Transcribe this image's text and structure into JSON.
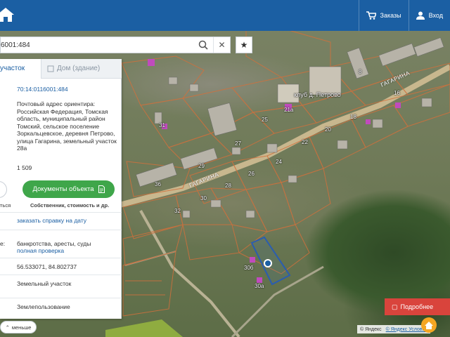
{
  "topbar": {
    "orders_label": "Заказы",
    "login_label": "Вход"
  },
  "search": {
    "value": "6001:484"
  },
  "panel": {
    "tabs": [
      {
        "label": "участок"
      },
      {
        "label": "Дом (здание)"
      }
    ],
    "cadastral_number": "70:14:0116001:484",
    "address": "Почтовый адрес ориентира: Российская Федерация, Томская область, муниципальный район Томский, сельское поселение Зоркальцевское, деревня Петрово, улица Гагарина, земельный участок 28а",
    "area": "1 509",
    "docs_button": "Документы объекта",
    "small_left": "ться",
    "small_right": "Собственник, стоимость и др.",
    "reference_link": "заказать справку на дату",
    "checks_label": "е:",
    "checks_text": "банкротства, аресты, суды",
    "full_check_link": "полная проверка",
    "coords": "56.533071, 84.802737",
    "parcel_type": "Земельный участок",
    "usage": "Землепользование",
    "less_button": "меньше"
  },
  "map": {
    "street_1": "ГАГАРИНА",
    "street_2": "ГАГАРИНА",
    "club_label": "клуб д. Петрово",
    "attribution_1": "© Яндекс",
    "attribution_2": "© Яндекс Условия",
    "badge_label": "Подробнее",
    "labels": [
      "21а",
      "25",
      "18",
      "20",
      "22",
      "27",
      "24",
      "26",
      "28",
      "29",
      "31",
      "30",
      "30б",
      "30а",
      "32",
      "36",
      "8",
      "16"
    ]
  },
  "colors": {
    "header": "#1b5fa3",
    "accent_green": "#3fa64a",
    "link": "#1b5fa3",
    "badge": "#d9443c"
  }
}
